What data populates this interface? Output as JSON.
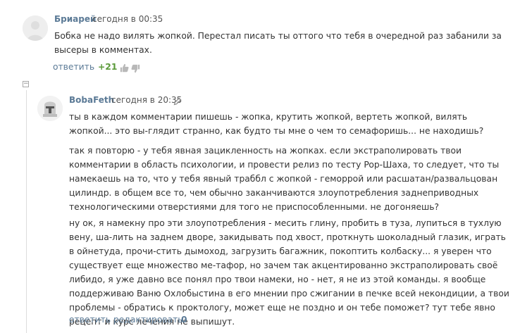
{
  "comment1": {
    "author": "Бриарей",
    "date": "сегодня в 00:35",
    "text": "Бобка не надо вилять жопкой. Перестал писать ты оттого что тебя в очередной раз забанили за высеры в комментах.",
    "reply_label": "ответить",
    "score": "+21",
    "score_color": "#5b9a3a",
    "like_icon": "thumbs-up-icon",
    "dislike_icon": "thumbs-down-icon"
  },
  "comment2": {
    "author": "BobaFeth",
    "date": "сегодня в 20:35",
    "edit_icon": "pencil-icon",
    "collapse_symbol": "−",
    "paragraphs": [
      "ты в каждом комментарии пишешь - жопка, крутить жопкой, вертеть  жопкой, вилять жопкой... это вы-глядит странно, как будто ты мне о чем то семафоришь... не находишь?",
      "так я повторю -  у тебя явная зацикленность на жопках. если экстраполировать твои комментарии в область психологии, и провести релиз по тесту Pop-Шаха, то следует, что ты намекаешь на то, что у тебя явный траббл с жопкой - геморрой или расшатан/развальцован цилиндр. в общем все то, чем обычно заканчиваются злоупотребления заднеприводных технологическими отверстиями для того не приспособленными. не догоняешь?",
      "ну ок, я намекну про эти злоупотребления - месить глину, пробить в туза, лупиться в тухлую вену, ша-лить на заднем дворе, закидывать под хвост, проткнуть шоколадный глазик, играть в ойнетуда, прочи-стить дымоход, загрузить багажник, покоптить колбаску... я уверен что существует еще множество ме-тафор, но зачем так акцентированно экстраполировать своё либидо, я уже давно все понял про твои намеки, но - нет, я не из этой команды. я вообще поддерживаю Ваню Охлобыстина в его мнении про сжигании в печке всей некондиции, а твои проблемы - обратись к проктологу, может еще не поздно и он тебе поможет? тут тебе явно рецепт и курс лечения не выпишут."
    ],
    "reply_label": "ответить",
    "edit_label": "редактировать",
    "score": "0",
    "score_color": "#5b7a96"
  }
}
